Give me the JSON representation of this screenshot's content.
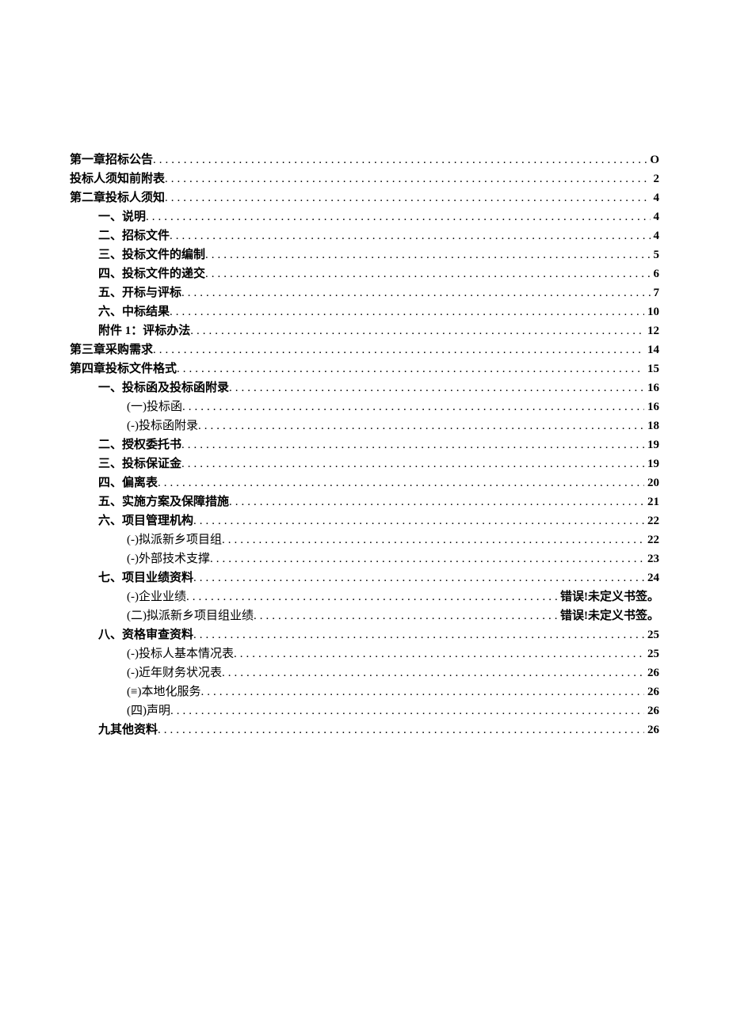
{
  "toc": [
    {
      "level": 0,
      "title": "第一章招标公告",
      "page": "O",
      "bold": true
    },
    {
      "level": 0,
      "title": "投标人须知前附表",
      "page": "2",
      "bold": true
    },
    {
      "level": 0,
      "title": "第二章投标人须知",
      "page": "4",
      "bold": true
    },
    {
      "level": 1,
      "title": "一、说明",
      "page": "4",
      "bold": true
    },
    {
      "level": 1,
      "title": "二、招标文件",
      "page": "4",
      "bold": true
    },
    {
      "level": 1,
      "title": "三、投标文件的编制",
      "page": "5",
      "bold": true
    },
    {
      "level": 1,
      "title": "四、投标文件的递交",
      "page": "6",
      "bold": true
    },
    {
      "level": 1,
      "title": "五、开标与评标",
      "page": "7",
      "bold": true
    },
    {
      "level": 1,
      "title": "六、中标结果",
      "page": "10",
      "bold": true
    },
    {
      "level": 1,
      "title": "附件 1：评标办法",
      "page": "12",
      "bold": true
    },
    {
      "level": 0,
      "title": "第三章采购需求",
      "page": "14",
      "bold": true
    },
    {
      "level": 0,
      "title": "第四章投标文件格式",
      "page": "15",
      "bold": true
    },
    {
      "level": 1,
      "title": "一、投标函及投标函附录",
      "page": "16",
      "bold": true
    },
    {
      "level": 2,
      "title": "(一)投标函",
      "page": "16",
      "bold": false,
      "page_bold": true
    },
    {
      "level": 2,
      "title": "(-)投标函附录",
      "page": "18",
      "bold": false,
      "page_bold": true
    },
    {
      "level": 1,
      "title": "二、授权委托书",
      "page": "19",
      "bold": true
    },
    {
      "level": 1,
      "title": "三、投标保证金",
      "page": "19",
      "bold": true
    },
    {
      "level": 1,
      "title": "四、偏离表",
      "page": "20",
      "bold": true
    },
    {
      "level": 1,
      "title": "五、实施方案及保障措施",
      "page": "21",
      "bold": true
    },
    {
      "level": 1,
      "title": "六、项目管理机构",
      "page": "22",
      "bold": true
    },
    {
      "level": 2,
      "title": "(-)拟派新乡项目组",
      "page": "22",
      "bold": false,
      "page_bold": true
    },
    {
      "level": 2,
      "title": "(-)外部技术支撑",
      "page": "23",
      "bold": false,
      "page_bold": true
    },
    {
      "level": 1,
      "title": "七、项目业绩资料",
      "page": "24",
      "bold": true
    },
    {
      "level": 2,
      "title": "(-)企业业绩",
      "page": "错误!未定义书签。",
      "bold": false,
      "page_bold": true
    },
    {
      "level": 2,
      "title": "(二)拟派新乡项目组业绩",
      "page": "错误!未定义书签。",
      "bold": false,
      "page_bold": true
    },
    {
      "level": 1,
      "title": "八、资格审查资料",
      "page": "25",
      "bold": true
    },
    {
      "level": 2,
      "title": "(-)投标人基本情况表",
      "page": "25",
      "bold": false,
      "page_bold": true
    },
    {
      "level": 2,
      "title": "(-)近年财务状况表",
      "page": "26",
      "bold": false,
      "page_bold": true
    },
    {
      "level": 2,
      "title": "(≡)本地化服务",
      "page": "26",
      "bold": false,
      "page_bold": true
    },
    {
      "level": 2,
      "title": "(四)声明",
      "page": "26",
      "bold": false,
      "page_bold": true
    },
    {
      "level": 1,
      "title": "九其他资料",
      "page": "26",
      "bold": true
    }
  ]
}
